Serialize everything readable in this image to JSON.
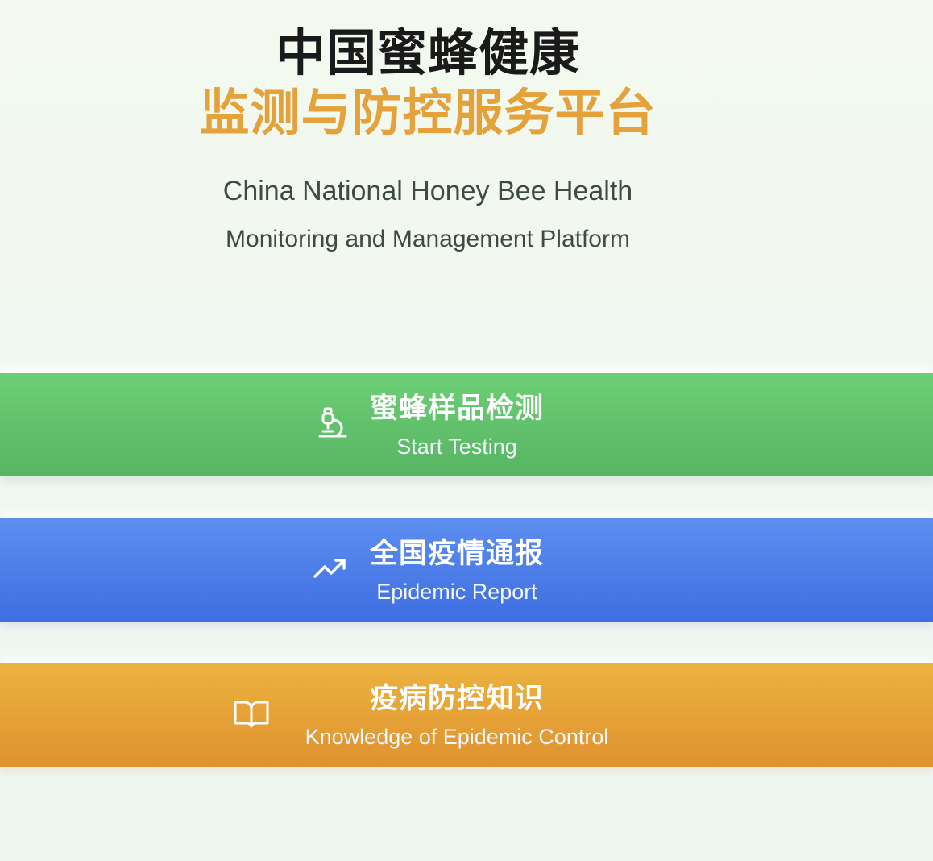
{
  "header": {
    "title_zh_line1": "中国蜜蜂健康",
    "title_zh_line2": "监测与防控服务平台",
    "title_en_line1": "China National Honey Bee Health",
    "title_en_line2": "Monitoring and Management Platform"
  },
  "colors": {
    "title_accent": "#e5a13a",
    "green": "#5fc16a",
    "blue": "#4a7ce8",
    "orange": "#e6a238"
  },
  "actions": [
    {
      "title": "蜜蜂样品检测",
      "subtitle": "Start Testing",
      "icon": "microscope-icon",
      "color": "green"
    },
    {
      "title": "全国疫情通报",
      "subtitle": "Epidemic Report",
      "icon": "trending-up-icon",
      "color": "blue"
    },
    {
      "title": "疫病防控知识",
      "subtitle": "Knowledge of Epidemic Control",
      "icon": "book-icon",
      "color": "orange"
    }
  ]
}
